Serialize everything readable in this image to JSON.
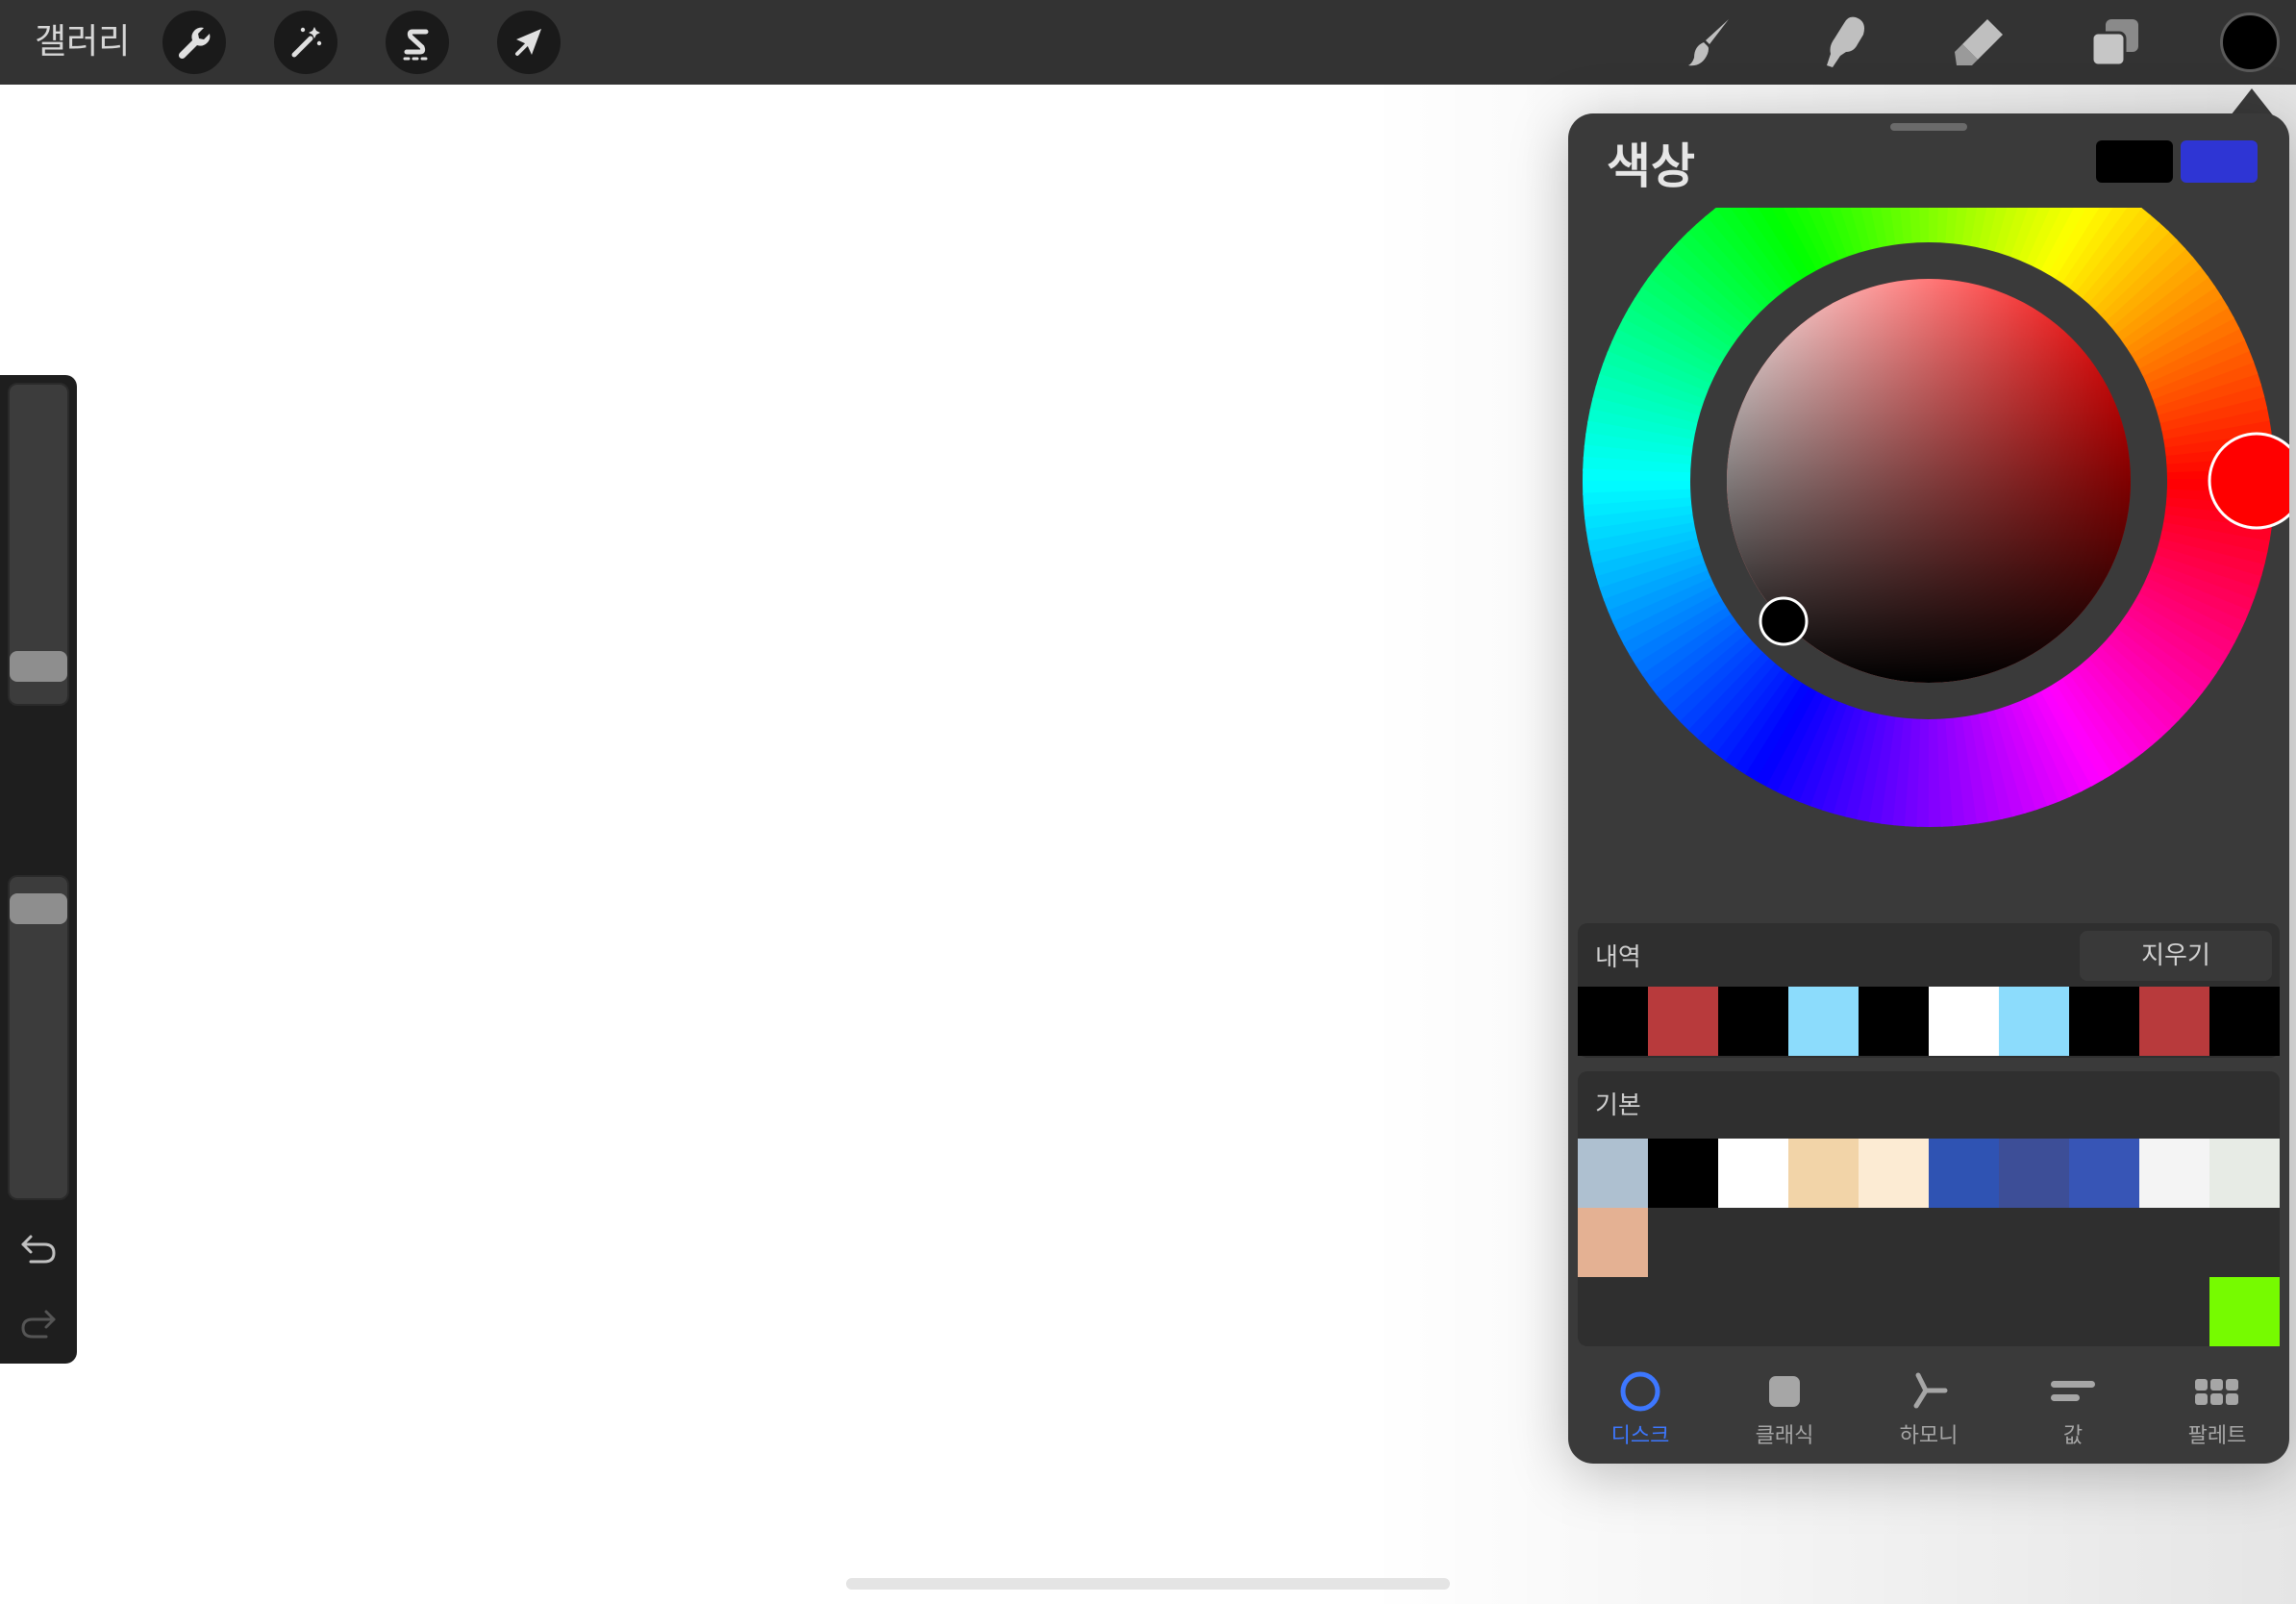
{
  "topbar": {
    "gallery_label": "갤러리",
    "left_tools": [
      {
        "name": "actions",
        "icon": "wrench-icon"
      },
      {
        "name": "adjustments",
        "icon": "magic-wand-icon"
      },
      {
        "name": "selection",
        "icon": "selection-s-icon"
      },
      {
        "name": "transform",
        "icon": "arrow-cursor-icon"
      }
    ],
    "right_tools": [
      {
        "name": "paint",
        "icon": "brush-icon"
      },
      {
        "name": "smudge",
        "icon": "smudge-finger-icon"
      },
      {
        "name": "erase",
        "icon": "eraser-icon"
      },
      {
        "name": "layers",
        "icon": "layers-icon"
      }
    ],
    "current_color": "#000000"
  },
  "sidebar": {
    "brush_size_level": 0.07,
    "opacity_level": 0.95,
    "modify_icon": "square-icon",
    "undo_icon": "undo-arrow-icon",
    "redo_icon": "redo-arrow-icon"
  },
  "color_panel": {
    "title": "색상",
    "primary_swatch": "#000000",
    "secondary_swatch": "#2e35d4",
    "wheel": {
      "selected_hue_deg": 0,
      "hue_handle_color": "#ff0000",
      "disc_handle_color": "#000000"
    },
    "history": {
      "label": "내역",
      "clear_label": "지우기",
      "swatches": [
        "#000000",
        "#b83a3c",
        "#000000",
        "#8cdcfc",
        "#000000",
        "#ffffff",
        "#8cdcfc",
        "#000000",
        "#b83a3c",
        "#000000"
      ]
    },
    "default": {
      "label": "기본",
      "row1": [
        "#aec0d0",
        "#000000",
        "#ffffff",
        "#f2d4a8",
        "#fcebd3",
        "#2f53b3",
        "#3d4e97",
        "#3755b6",
        "#f4f4f4",
        "#e7ebe5"
      ],
      "row2": [
        "#e4b193"
      ],
      "extra_swatch": "#76fb00"
    },
    "tabs": [
      {
        "label": "디스크",
        "icon": "disc-ring-icon",
        "active": true
      },
      {
        "label": "클래식",
        "icon": "square-rounded-icon",
        "active": false
      },
      {
        "label": "하모니",
        "icon": "harmony-icon",
        "active": false
      },
      {
        "label": "값",
        "icon": "value-bars-icon",
        "active": false
      },
      {
        "label": "팔레트",
        "icon": "palette-grid-icon",
        "active": false
      }
    ],
    "accent_color": "#3d77ff"
  }
}
